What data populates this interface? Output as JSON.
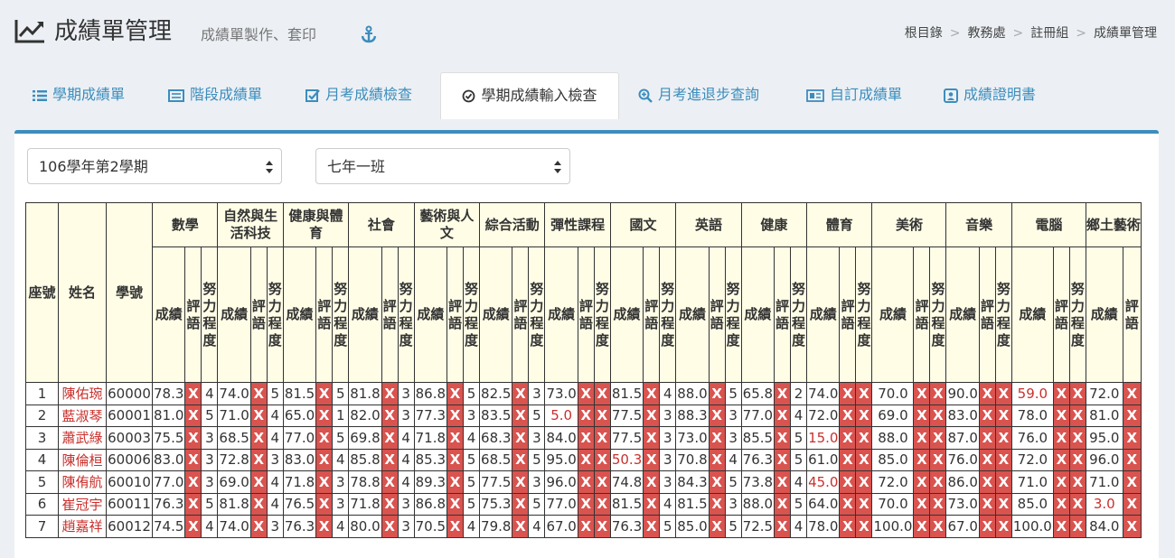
{
  "header": {
    "title": "成績單管理",
    "subtitle": "成績單製作、套印",
    "icon": "chart-line-icon"
  },
  "breadcrumb": [
    "根目錄",
    "教務處",
    "註冊組",
    "成績單管理"
  ],
  "tabs": [
    {
      "label": "學期成績單",
      "icon": "list-icon"
    },
    {
      "label": "階段成績單",
      "icon": "card-icon"
    },
    {
      "label": "月考成績檢查",
      "icon": "check-square-icon"
    },
    {
      "label": "學期成績輸入檢查",
      "icon": "check-circle-icon",
      "active": true
    },
    {
      "label": "月考進退步查詢",
      "icon": "search-plus-icon"
    },
    {
      "label": "自訂成績單",
      "icon": "newspaper-icon"
    },
    {
      "label": "成績證明書",
      "icon": "id-badge-icon"
    }
  ],
  "semester_select": {
    "value": "106學年第2學期"
  },
  "class_select": {
    "value": "七年一班"
  },
  "table": {
    "fixed_headers": {
      "seat": "座號",
      "name": "姓名",
      "id": "學號"
    },
    "sub_headers": {
      "score": "成績",
      "comment": "評語",
      "effort": "努力程度"
    },
    "subjects": [
      "數學",
      "自然與生活科技",
      "健康與體育",
      "社會",
      "藝術與人文",
      "綜合活動",
      "彈性課程",
      "國文",
      "英語",
      "健康",
      "體育",
      "美術",
      "音樂",
      "電腦",
      "鄉土藝術"
    ],
    "missing_mark": "X",
    "rows": [
      {
        "seat": "1",
        "name": "陳佑琬",
        "id": "60000",
        "cells": [
          [
            "78.3",
            "X",
            "4"
          ],
          [
            "74.0",
            "X",
            "5"
          ],
          [
            "81.5",
            "X",
            "5"
          ],
          [
            "81.8",
            "X",
            "3"
          ],
          [
            "86.8",
            "X",
            "5"
          ],
          [
            "82.5",
            "X",
            "3"
          ],
          [
            "73.0",
            "X",
            "X"
          ],
          [
            "81.5",
            "X",
            "4"
          ],
          [
            "88.0",
            "X",
            "5"
          ],
          [
            "65.8",
            "X",
            "2"
          ],
          [
            "74.0",
            "X",
            "X"
          ],
          [
            "70.0",
            "X",
            "X"
          ],
          [
            "90.0",
            "X",
            "X"
          ],
          [
            "59.0",
            "X",
            "X"
          ],
          [
            "72.0",
            "X"
          ]
        ]
      },
      {
        "seat": "2",
        "name": "藍淑琴",
        "id": "60001",
        "cells": [
          [
            "81.0",
            "X",
            "5"
          ],
          [
            "71.0",
            "X",
            "4"
          ],
          [
            "65.0",
            "X",
            "1"
          ],
          [
            "82.0",
            "X",
            "3"
          ],
          [
            "77.3",
            "X",
            "3"
          ],
          [
            "83.5",
            "X",
            "5"
          ],
          [
            "5.0",
            "X",
            "X"
          ],
          [
            "77.5",
            "X",
            "3"
          ],
          [
            "88.3",
            "X",
            "3"
          ],
          [
            "77.0",
            "X",
            "4"
          ],
          [
            "72.0",
            "X",
            "X"
          ],
          [
            "69.0",
            "X",
            "X"
          ],
          [
            "83.0",
            "X",
            "X"
          ],
          [
            "78.0",
            "X",
            "X"
          ],
          [
            "81.0",
            "X"
          ]
        ]
      },
      {
        "seat": "3",
        "name": "蕭武綠",
        "id": "60003",
        "cells": [
          [
            "75.5",
            "X",
            "3"
          ],
          [
            "68.5",
            "X",
            "4"
          ],
          [
            "77.0",
            "X",
            "5"
          ],
          [
            "69.8",
            "X",
            "4"
          ],
          [
            "71.8",
            "X",
            "4"
          ],
          [
            "68.3",
            "X",
            "3"
          ],
          [
            "84.0",
            "X",
            "X"
          ],
          [
            "77.5",
            "X",
            "3"
          ],
          [
            "73.0",
            "X",
            "3"
          ],
          [
            "85.5",
            "X",
            "5"
          ],
          [
            "15.0",
            "X",
            "X"
          ],
          [
            "88.0",
            "X",
            "X"
          ],
          [
            "87.0",
            "X",
            "X"
          ],
          [
            "76.0",
            "X",
            "X"
          ],
          [
            "95.0",
            "X"
          ]
        ]
      },
      {
        "seat": "4",
        "name": "陳倫桓",
        "id": "60006",
        "cells": [
          [
            "83.0",
            "X",
            "3"
          ],
          [
            "72.8",
            "X",
            "3"
          ],
          [
            "83.0",
            "X",
            "4"
          ],
          [
            "85.8",
            "X",
            "4"
          ],
          [
            "85.3",
            "X",
            "5"
          ],
          [
            "68.5",
            "X",
            "5"
          ],
          [
            "95.0",
            "X",
            "X"
          ],
          [
            "50.3",
            "X",
            "3"
          ],
          [
            "70.8",
            "X",
            "4"
          ],
          [
            "76.3",
            "X",
            "5"
          ],
          [
            "61.0",
            "X",
            "X"
          ],
          [
            "85.0",
            "X",
            "X"
          ],
          [
            "76.0",
            "X",
            "X"
          ],
          [
            "72.0",
            "X",
            "X"
          ],
          [
            "96.0",
            "X"
          ]
        ]
      },
      {
        "seat": "5",
        "name": "陳侑航",
        "id": "60010",
        "cells": [
          [
            "77.0",
            "X",
            "3"
          ],
          [
            "69.0",
            "X",
            "4"
          ],
          [
            "71.8",
            "X",
            "3"
          ],
          [
            "78.8",
            "X",
            "4"
          ],
          [
            "89.3",
            "X",
            "5"
          ],
          [
            "77.5",
            "X",
            "3"
          ],
          [
            "96.0",
            "X",
            "X"
          ],
          [
            "74.8",
            "X",
            "3"
          ],
          [
            "84.3",
            "X",
            "5"
          ],
          [
            "73.8",
            "X",
            "4"
          ],
          [
            "45.0",
            "X",
            "X"
          ],
          [
            "72.0",
            "X",
            "X"
          ],
          [
            "86.0",
            "X",
            "X"
          ],
          [
            "71.0",
            "X",
            "X"
          ],
          [
            "71.0",
            "X"
          ]
        ]
      },
      {
        "seat": "6",
        "name": "崔冠宇",
        "id": "60011",
        "cells": [
          [
            "76.3",
            "X",
            "5"
          ],
          [
            "81.8",
            "X",
            "4"
          ],
          [
            "76.5",
            "X",
            "3"
          ],
          [
            "71.8",
            "X",
            "3"
          ],
          [
            "86.8",
            "X",
            "5"
          ],
          [
            "75.3",
            "X",
            "5"
          ],
          [
            "77.0",
            "X",
            "X"
          ],
          [
            "81.5",
            "X",
            "4"
          ],
          [
            "81.5",
            "X",
            "3"
          ],
          [
            "88.0",
            "X",
            "5"
          ],
          [
            "64.0",
            "X",
            "X"
          ],
          [
            "70.0",
            "X",
            "X"
          ],
          [
            "73.0",
            "X",
            "X"
          ],
          [
            "85.0",
            "X",
            "X"
          ],
          [
            "3.0",
            "X"
          ]
        ]
      },
      {
        "seat": "7",
        "name": "趙嘉祥",
        "id": "60012",
        "cells": [
          [
            "74.5",
            "X",
            "4"
          ],
          [
            "74.0",
            "X",
            "3"
          ],
          [
            "76.3",
            "X",
            "4"
          ],
          [
            "80.0",
            "X",
            "3"
          ],
          [
            "70.5",
            "X",
            "4"
          ],
          [
            "79.8",
            "X",
            "4"
          ],
          [
            "67.0",
            "X",
            "X"
          ],
          [
            "76.3",
            "X",
            "5"
          ],
          [
            "85.0",
            "X",
            "5"
          ],
          [
            "72.5",
            "X",
            "4"
          ],
          [
            "78.0",
            "X",
            "X"
          ],
          [
            "100.0",
            "X",
            "X"
          ],
          [
            "67.0",
            "X",
            "X"
          ],
          [
            "100.0",
            "X",
            "X"
          ],
          [
            "84.0",
            "X"
          ]
        ]
      }
    ]
  },
  "colors": {
    "accent": "#3c8dbc",
    "missing": "#d9534f",
    "low_score": "#c9302c",
    "header_bg": "#fffde6"
  }
}
